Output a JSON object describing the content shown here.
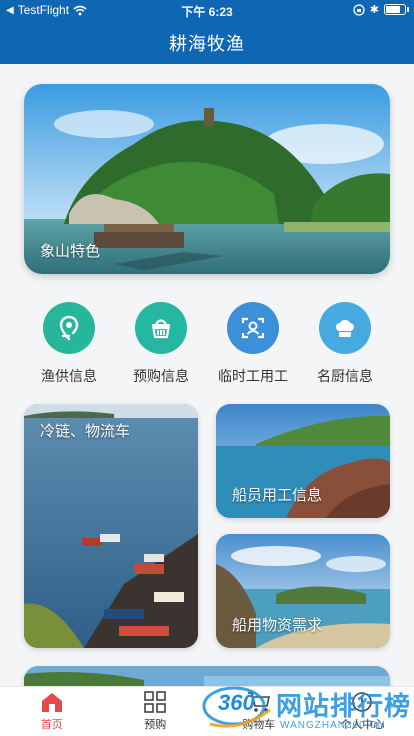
{
  "status": {
    "carrier": "TestFlight",
    "time": "下午 6:23"
  },
  "nav": {
    "title": "耕海牧渔"
  },
  "hero": {
    "caption": "象山特色"
  },
  "icons": [
    {
      "label": "渔供信息",
      "icon": "location-pin-icon",
      "color": "#26b79a"
    },
    {
      "label": "预购信息",
      "icon": "basket-icon",
      "color": "#26b7a3"
    },
    {
      "label": "临时工用工",
      "icon": "face-scan-icon",
      "color": "#3c8fd9"
    },
    {
      "label": "名厨信息",
      "icon": "chef-hat-icon",
      "color": "#46a9e0"
    }
  ],
  "cards": {
    "logistics": "冷链、物流车",
    "crew": "船员用工信息",
    "supplies": "船用物资需求"
  },
  "tabs": [
    {
      "label": "首页",
      "icon": "home-icon",
      "active": true
    },
    {
      "label": "预购",
      "icon": "grid-icon",
      "active": false
    },
    {
      "label": "购物车",
      "icon": "cart-icon",
      "active": false
    },
    {
      "label": "个人中心",
      "icon": "user-icon",
      "active": false
    }
  ],
  "watermark": {
    "brand": "360",
    "text": "网站排行榜",
    "url": "WANGZHAN360.CN"
  }
}
